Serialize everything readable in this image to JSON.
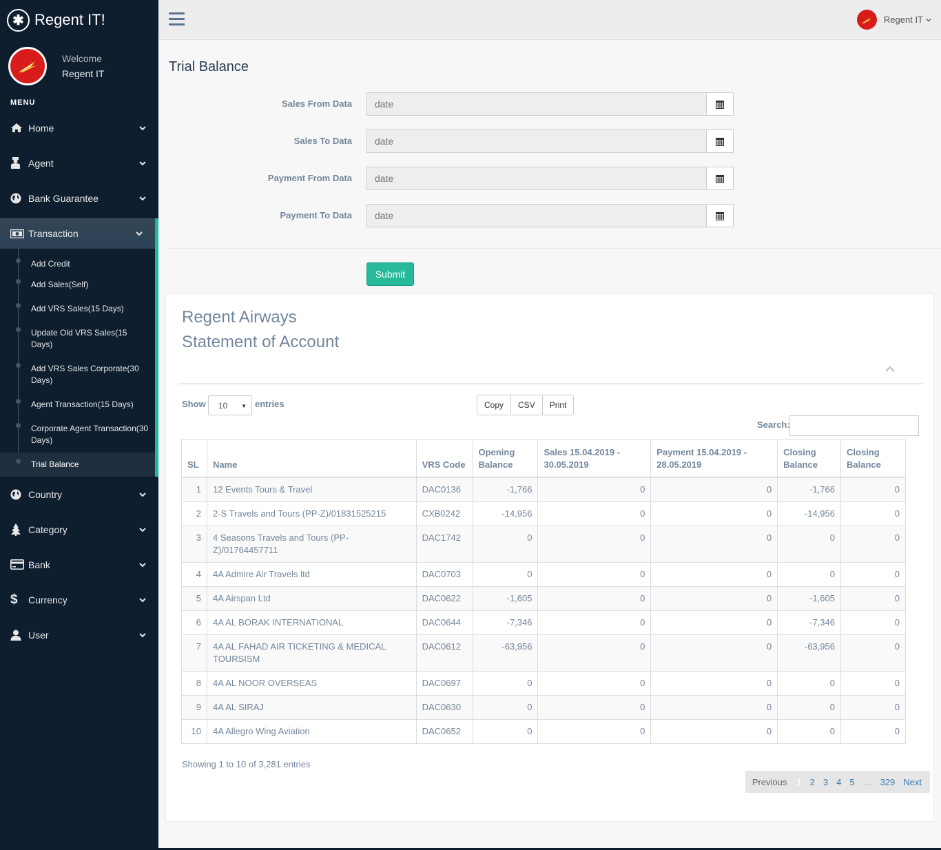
{
  "brand": {
    "name": "Regent IT!"
  },
  "profile": {
    "welcome": "Welcome",
    "name": "Regent IT"
  },
  "menu_title": "MENU",
  "nav": [
    {
      "label": "Home",
      "icon": "home-icon"
    },
    {
      "label": "Agent",
      "icon": "agent-icon"
    },
    {
      "label": "Bank Guarantee",
      "icon": "globe-icon"
    },
    {
      "label": "Transaction",
      "icon": "money-icon"
    },
    {
      "label": "Country",
      "icon": "globe-icon"
    },
    {
      "label": "Category",
      "icon": "tree-icon"
    },
    {
      "label": "Bank",
      "icon": "credit-card-icon"
    },
    {
      "label": "Currency",
      "icon": "dollar-icon"
    },
    {
      "label": "User",
      "icon": "user-icon"
    }
  ],
  "submenu": [
    {
      "label": "Add Credit"
    },
    {
      "label": "Add Sales(Self)"
    },
    {
      "label": "Add VRS Sales(15 Days)"
    },
    {
      "label": "Update Old VRS Sales(15 Days)"
    },
    {
      "label": "Add VRS Sales Corporate(30 Days)"
    },
    {
      "label": "Agent Transaction(15 Days)"
    },
    {
      "label": "Corporate Agent Transaction(30 Days)"
    },
    {
      "label": "Trial Balance"
    }
  ],
  "topnav": {
    "user": "Regent IT"
  },
  "page": {
    "title": "Trial Balance"
  },
  "form": {
    "fields": [
      {
        "label": "Sales From Data",
        "placeholder": "date"
      },
      {
        "label": "Sales To Data",
        "placeholder": "date"
      },
      {
        "label": "Payment From Data",
        "placeholder": "date"
      },
      {
        "label": "Payment To Data",
        "placeholder": "date"
      }
    ],
    "submit": "Submit"
  },
  "report": {
    "title1": "Regent Airways",
    "title2": "Statement of Account",
    "show": "Show",
    "page_length": "10",
    "entries": "entries",
    "buttons": [
      "Copy",
      "CSV",
      "Print"
    ],
    "search_label": "Search:",
    "columns": [
      "SL",
      "Name",
      "VRS Code",
      "Opening Balance",
      "Sales 15.04.2019 - 30.05.2019",
      "Payment 15.04.2019 - 28.05.2019",
      "Closing Balance",
      "Closing Balance"
    ],
    "rows": [
      [
        "1",
        "12 Events Tours & Travel",
        "DAC0136",
        "-1,766",
        "0",
        "0",
        "-1,766",
        "0"
      ],
      [
        "2",
        "2-S Travels and Tours (PP-Z)/01831525215",
        "CXB0242",
        "-14,956",
        "0",
        "0",
        "-14,956",
        "0"
      ],
      [
        "3",
        "4 Seasons Travels and Tours (PP-Z)/01764457711",
        "DAC1742",
        "0",
        "0",
        "0",
        "0",
        "0"
      ],
      [
        "4",
        "4A Admire Air Travels ltd",
        "DAC0703",
        "0",
        "0",
        "0",
        "0",
        "0"
      ],
      [
        "5",
        "4A Airspan Ltd",
        "DAC0622",
        "-1,605",
        "0",
        "0",
        "-1,605",
        "0"
      ],
      [
        "6",
        "4A AL BORAK INTERNATIONAL",
        "DAC0644",
        "-7,346",
        "0",
        "0",
        "-7,346",
        "0"
      ],
      [
        "7",
        "4A AL FAHAD AIR TICKETING & MEDICAL TOURSISM",
        "DAC0612",
        "-63,956",
        "0",
        "0",
        "-63,956",
        "0"
      ],
      [
        "8",
        "4A AL NOOR OVERSEAS",
        "DAC0697",
        "0",
        "0",
        "0",
        "0",
        "0"
      ],
      [
        "9",
        "4A AL SIRAJ",
        "DAC0630",
        "0",
        "0",
        "0",
        "0",
        "0"
      ],
      [
        "10",
        "4A Allegro Wing Aviation",
        "DAC0652",
        "0",
        "0",
        "0",
        "0",
        "0"
      ]
    ],
    "info": "Showing 1 to 10 of 3,281 entries",
    "pagination": {
      "previous": "Previous",
      "pages": [
        "1",
        "2",
        "3",
        "4",
        "5",
        "…",
        "329"
      ],
      "next": "Next"
    }
  },
  "colors": {
    "sidebar": "#0e1e2f",
    "accent": "#1abb9c",
    "submit": "#26b99a",
    "avatar": "#d81c1c"
  }
}
